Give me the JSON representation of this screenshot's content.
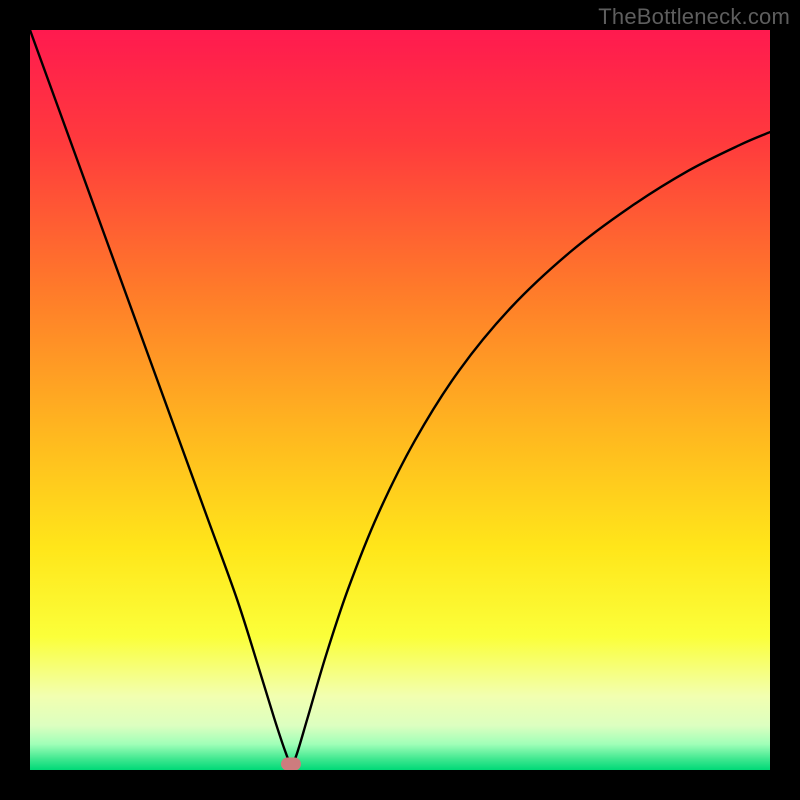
{
  "watermark": "TheBottleneck.com",
  "colors": {
    "frame": "#000000",
    "watermark_text": "#5e5e5e",
    "curve": "#000000",
    "marker": "#cd7c7e",
    "gradient_stops": [
      {
        "offset": 0.0,
        "color": "#ff1a4f"
      },
      {
        "offset": 0.15,
        "color": "#ff3a3d"
      },
      {
        "offset": 0.35,
        "color": "#ff7a2a"
      },
      {
        "offset": 0.55,
        "color": "#ffb91f"
      },
      {
        "offset": 0.7,
        "color": "#ffe61a"
      },
      {
        "offset": 0.82,
        "color": "#fbff3a"
      },
      {
        "offset": 0.9,
        "color": "#f2ffb0"
      },
      {
        "offset": 0.94,
        "color": "#dcffc0"
      },
      {
        "offset": 0.965,
        "color": "#a0ffb8"
      },
      {
        "offset": 0.985,
        "color": "#40e890"
      },
      {
        "offset": 1.0,
        "color": "#00d977"
      }
    ]
  },
  "chart_data": {
    "type": "line",
    "title": "",
    "xlabel": "",
    "ylabel": "",
    "xlim": [
      0,
      1
    ],
    "ylim": [
      0,
      1
    ],
    "grid": false,
    "legend": false,
    "marker": {
      "x": 0.353,
      "y": 0.008
    },
    "series": [
      {
        "name": "curve",
        "points": [
          {
            "x": 0.0,
            "y": 1.0
          },
          {
            "x": 0.04,
            "y": 0.89
          },
          {
            "x": 0.08,
            "y": 0.78
          },
          {
            "x": 0.12,
            "y": 0.67
          },
          {
            "x": 0.16,
            "y": 0.56
          },
          {
            "x": 0.2,
            "y": 0.45
          },
          {
            "x": 0.24,
            "y": 0.34
          },
          {
            "x": 0.28,
            "y": 0.23
          },
          {
            "x": 0.31,
            "y": 0.135
          },
          {
            "x": 0.33,
            "y": 0.07
          },
          {
            "x": 0.345,
            "y": 0.025
          },
          {
            "x": 0.353,
            "y": 0.008
          },
          {
            "x": 0.36,
            "y": 0.02
          },
          {
            "x": 0.375,
            "y": 0.07
          },
          {
            "x": 0.4,
            "y": 0.155
          },
          {
            "x": 0.43,
            "y": 0.245
          },
          {
            "x": 0.47,
            "y": 0.345
          },
          {
            "x": 0.52,
            "y": 0.445
          },
          {
            "x": 0.58,
            "y": 0.54
          },
          {
            "x": 0.65,
            "y": 0.625
          },
          {
            "x": 0.73,
            "y": 0.7
          },
          {
            "x": 0.81,
            "y": 0.76
          },
          {
            "x": 0.89,
            "y": 0.81
          },
          {
            "x": 0.96,
            "y": 0.845
          },
          {
            "x": 1.0,
            "y": 0.862
          }
        ]
      }
    ]
  }
}
